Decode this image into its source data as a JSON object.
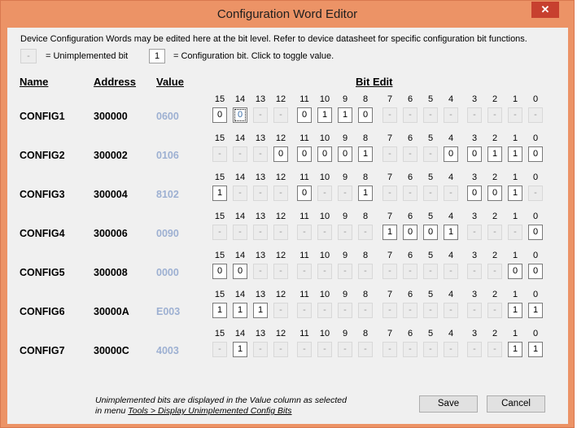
{
  "window": {
    "title": "Configuration Word Editor",
    "close_label": "✕"
  },
  "description": "Device Configuration Words may be edited here at the bit level.  Refer to device datasheet for specific configuration bit functions.",
  "legend": {
    "unimpl_symbol": "-",
    "unimpl_text": "= Unimplemented bit",
    "impl_symbol": "1",
    "impl_text": "= Configuration bit.  Click to toggle value."
  },
  "headers": {
    "name": "Name",
    "address": "Address",
    "value": "Value",
    "bit_edit": "Bit Edit"
  },
  "bit_numbers": [
    "15",
    "14",
    "13",
    "12",
    "11",
    "10",
    "9",
    "8",
    "7",
    "6",
    "5",
    "4",
    "3",
    "2",
    "1",
    "0"
  ],
  "configs": [
    {
      "name": "CONFIG1",
      "address": "300000",
      "value": "0600",
      "bits": [
        "0",
        "0",
        "-",
        "-",
        "0",
        "1",
        "1",
        "0",
        "-",
        "-",
        "-",
        "-",
        "-",
        "-",
        "-",
        "-"
      ]
    },
    {
      "name": "CONFIG2",
      "address": "300002",
      "value": "0106",
      "bits": [
        "-",
        "-",
        "-",
        "0",
        "0",
        "0",
        "0",
        "1",
        "-",
        "-",
        "-",
        "0",
        "0",
        "1",
        "1",
        "0"
      ]
    },
    {
      "name": "CONFIG3",
      "address": "300004",
      "value": "8102",
      "bits": [
        "1",
        "-",
        "-",
        "-",
        "0",
        "-",
        "-",
        "1",
        "-",
        "-",
        "-",
        "-",
        "0",
        "0",
        "1",
        "-"
      ]
    },
    {
      "name": "CONFIG4",
      "address": "300006",
      "value": "0090",
      "bits": [
        "-",
        "-",
        "-",
        "-",
        "-",
        "-",
        "-",
        "-",
        "1",
        "0",
        "0",
        "1",
        "-",
        "-",
        "-",
        "0"
      ]
    },
    {
      "name": "CONFIG5",
      "address": "300008",
      "value": "0000",
      "bits": [
        "0",
        "0",
        "-",
        "-",
        "-",
        "-",
        "-",
        "-",
        "-",
        "-",
        "-",
        "-",
        "-",
        "-",
        "0",
        "0"
      ]
    },
    {
      "name": "CONFIG6",
      "address": "30000A",
      "value": "E003",
      "bits": [
        "1",
        "1",
        "1",
        "-",
        "-",
        "-",
        "-",
        "-",
        "-",
        "-",
        "-",
        "-",
        "-",
        "-",
        "1",
        "1"
      ]
    },
    {
      "name": "CONFIG7",
      "address": "30000C",
      "value": "4003",
      "bits": [
        "-",
        "1",
        "-",
        "-",
        "-",
        "-",
        "-",
        "-",
        "-",
        "-",
        "-",
        "-",
        "-",
        "-",
        "1",
        "1"
      ]
    }
  ],
  "focused_bit": {
    "row": 0,
    "bit": 1
  },
  "footer": {
    "note_line1": "Unimplemented bits are displayed in the Value column as selected",
    "note_prefix": "in menu  ",
    "note_menu_path": "Tools > Display Unimplemented Config Bits"
  },
  "buttons": {
    "save": "Save",
    "cancel": "Cancel"
  },
  "colors": {
    "window_frame": "#ec9366",
    "close_button": "#c7402f",
    "value_text": "#9db0d2"
  }
}
